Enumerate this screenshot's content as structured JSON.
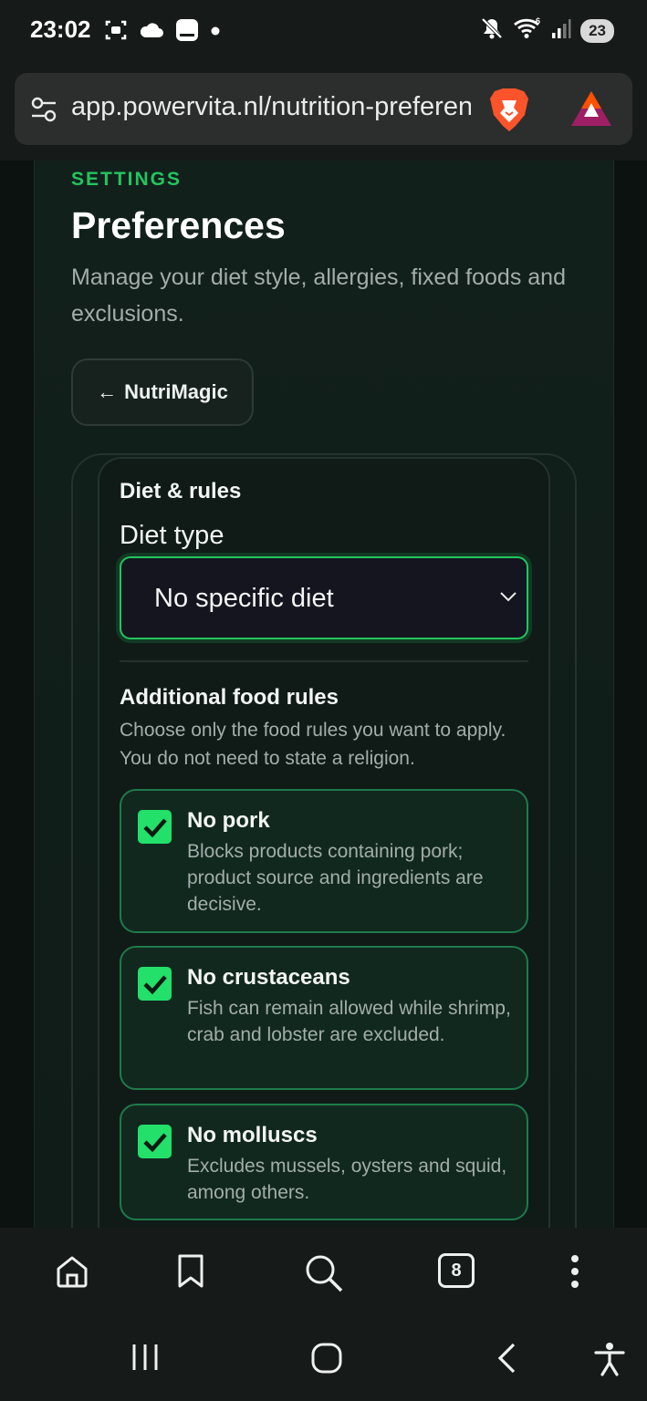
{
  "status_bar": {
    "time": "23:02",
    "battery": "23",
    "icons": [
      "screenshot-icon",
      "cloud-icon",
      "notification-icon",
      "dot-icon",
      "mute-icon",
      "wifi-icon",
      "signal-icon"
    ]
  },
  "browser": {
    "url": "app.powervita.nl/nutrition-preferences",
    "tab_count": "8",
    "icons": [
      "tune-icon",
      "brave-lion-icon",
      "bat-rewards-icon",
      "home-icon",
      "bookmark-icon",
      "search-icon",
      "tabs-icon",
      "more-icon"
    ]
  },
  "page": {
    "eyebrow": "SETTINGS",
    "title": "Preferences",
    "subtitle": "Manage your diet style, allergies, fixed foods and exclusions.",
    "back_label": "NutriMagic",
    "back_arrow": "←"
  },
  "diet": {
    "section_title": "Diet & rules",
    "diet_type_label": "Diet type",
    "diet_type_value": "No specific diet"
  },
  "rules": {
    "title": "Additional food rules",
    "description": "Choose only the food rules you want to apply. You do not need to state a religion.",
    "items": [
      {
        "name": "No pork",
        "description": "Blocks products containing pork; product source and ingredients are decisive.",
        "checked": true
      },
      {
        "name": "No crustaceans",
        "description": "Fish can remain allowed while shrimp, crab and lobster are excluded.",
        "checked": true
      },
      {
        "name": "No molluscs",
        "description": "Excludes mussels, oysters and squid, among others.",
        "checked": true
      }
    ]
  },
  "colors": {
    "accent": "#22c55e",
    "checkbox": "#22e06a",
    "background": "#0b1210"
  }
}
